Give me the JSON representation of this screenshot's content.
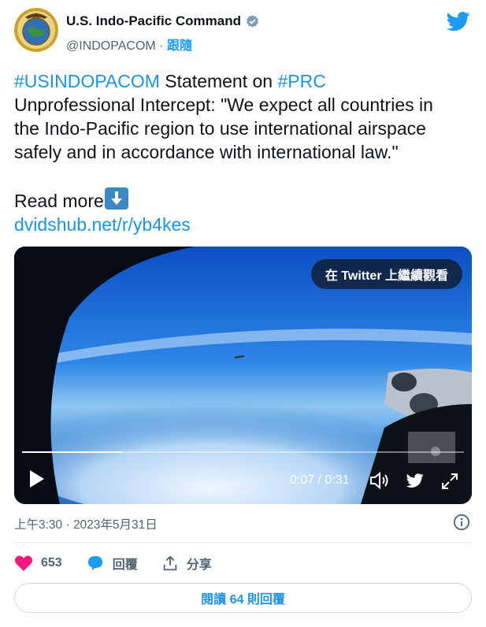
{
  "account": {
    "name": "U.S. Indo-Pacific Command",
    "handle": "@INDOPACOM",
    "separator": " · ",
    "follow_label": "跟隨"
  },
  "tweet": {
    "line1_hashtag1": "#USINDOPACOM",
    "line1_mid": " Statement on ",
    "line1_hashtag2": "#PRC",
    "line2": "Unprofessional Intercept: \"We expect all countries in",
    "line3": "the Indo-Pacific region to use international airspace",
    "line4": "safely and in accordance with international law.\"",
    "read_more": "Read more",
    "link": "dvidshub.net/r/yb4kes"
  },
  "video": {
    "watch_on_twitter": "在 Twitter 上繼續觀看",
    "time": "0:07 / 0:31",
    "progress": 0.226,
    "icons": [
      "play-icon",
      "volume-icon",
      "twitter-bird-icon",
      "fullscreen-icon"
    ]
  },
  "meta": {
    "timestamp": "上午3:30 · 2023年5月31日"
  },
  "actions": {
    "like_count": "653",
    "reply_label": "回覆",
    "share_label": "分享"
  },
  "read_replies": "閱讀 64 則回覆",
  "colors": {
    "link": "#1b95e0",
    "like": "#f91880",
    "twitter_blue": "#1d9bf0",
    "text": "#0f1419",
    "muted": "#536471"
  }
}
